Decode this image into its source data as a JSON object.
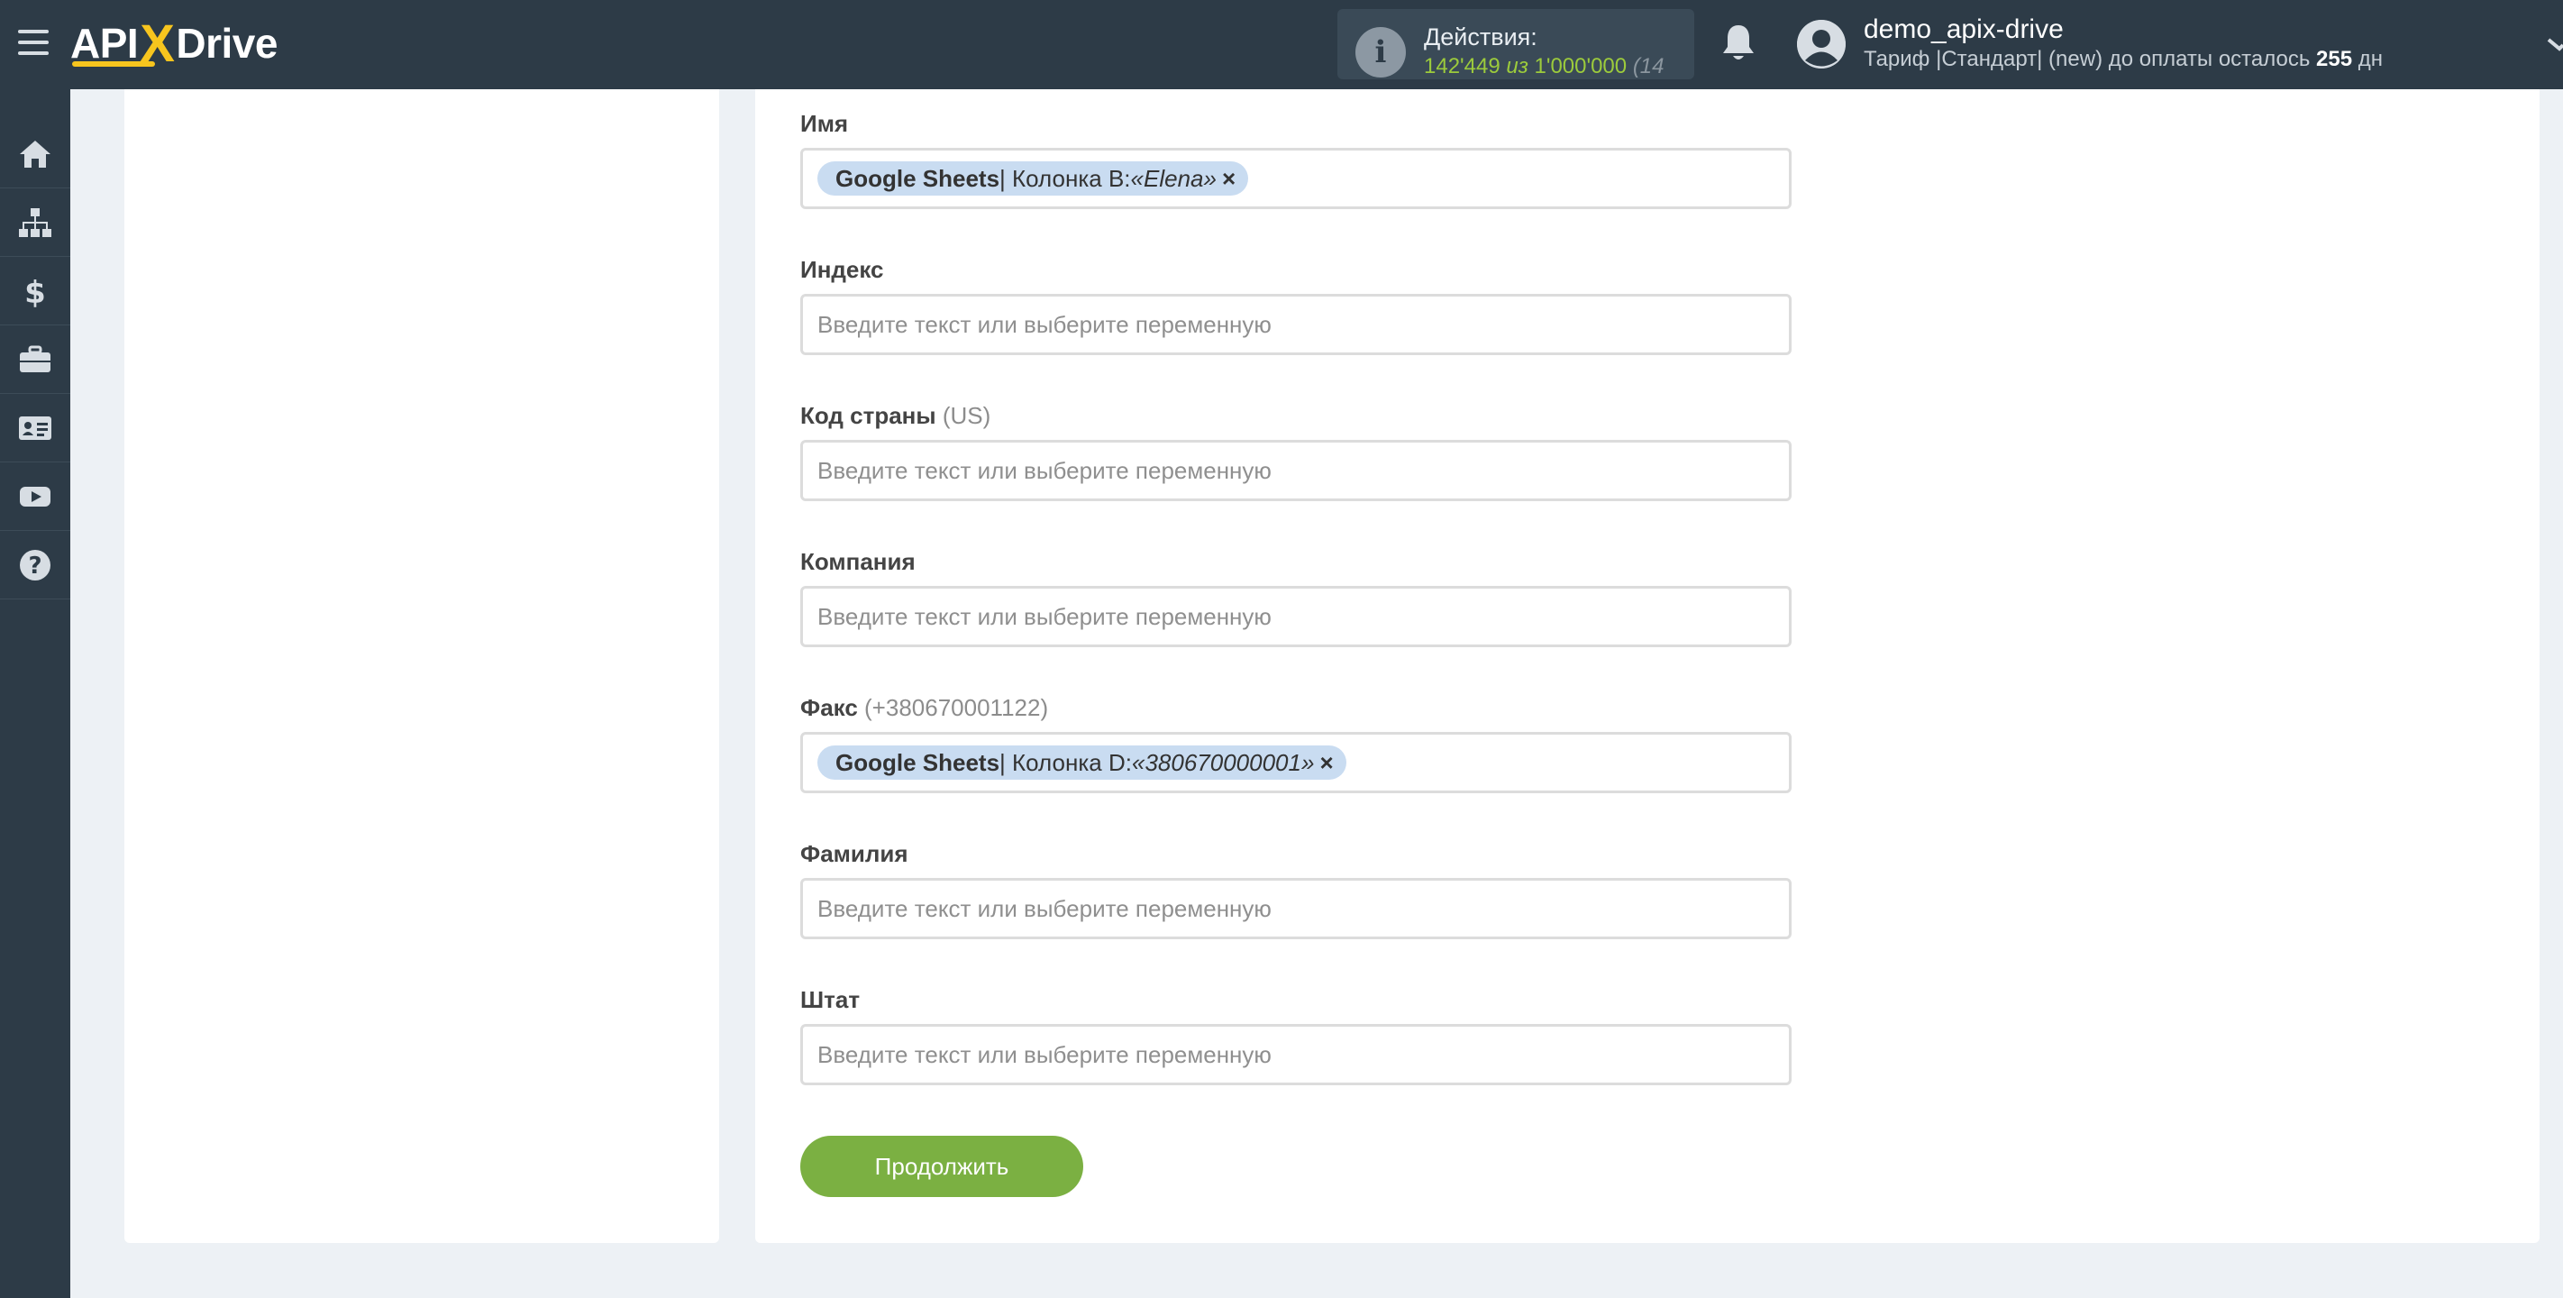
{
  "header": {
    "logo_left": "API",
    "logo_x": "X",
    "logo_right": "Drive",
    "actions_label": "Действия:",
    "actions_used": "142'449",
    "actions_of": "из",
    "actions_total": "1'000'000",
    "actions_extra": "(14",
    "user_name": "demo_apix-drive",
    "plan_text": "Тариф |Стандарт| (new) до оплаты осталось",
    "plan_days": "255",
    "plan_days_unit": "дн"
  },
  "sidebar": {
    "items": [
      "home-icon",
      "sitemap-icon",
      "dollar-icon",
      "briefcase-icon",
      "id-card-icon",
      "youtube-icon",
      "help-icon"
    ]
  },
  "form": {
    "fields": [
      {
        "label": "Имя",
        "hint": "",
        "tag": {
          "source": "Google Sheets",
          "column": " | Колонка B: ",
          "value": "«Elena»",
          "remove": "×"
        }
      },
      {
        "label": "Индекс",
        "hint": "",
        "placeholder": "Введите текст или выберите переменную"
      },
      {
        "label": "Код страны",
        "hint": "(US)",
        "placeholder": "Введите текст или выберите переменную"
      },
      {
        "label": "Компания",
        "hint": "",
        "placeholder": "Введите текст или выберите переменную"
      },
      {
        "label": "Факс",
        "hint": "(+380670001122)",
        "tag": {
          "source": "Google Sheets",
          "column": " | Колонка D: ",
          "value": "«380670000001»",
          "remove": "×"
        }
      },
      {
        "label": "Фамилия",
        "hint": "",
        "placeholder": "Введите текст или выберите переменную"
      },
      {
        "label": "Штат",
        "hint": "",
        "placeholder": "Введите текст или выберите переменную"
      }
    ],
    "continue_label": "Продолжить"
  },
  "colors": {
    "topbar": "#2d3b47",
    "accent_yellow": "#f7c51e",
    "green": "#7bb042",
    "tag_bg": "#c9dcf1"
  }
}
